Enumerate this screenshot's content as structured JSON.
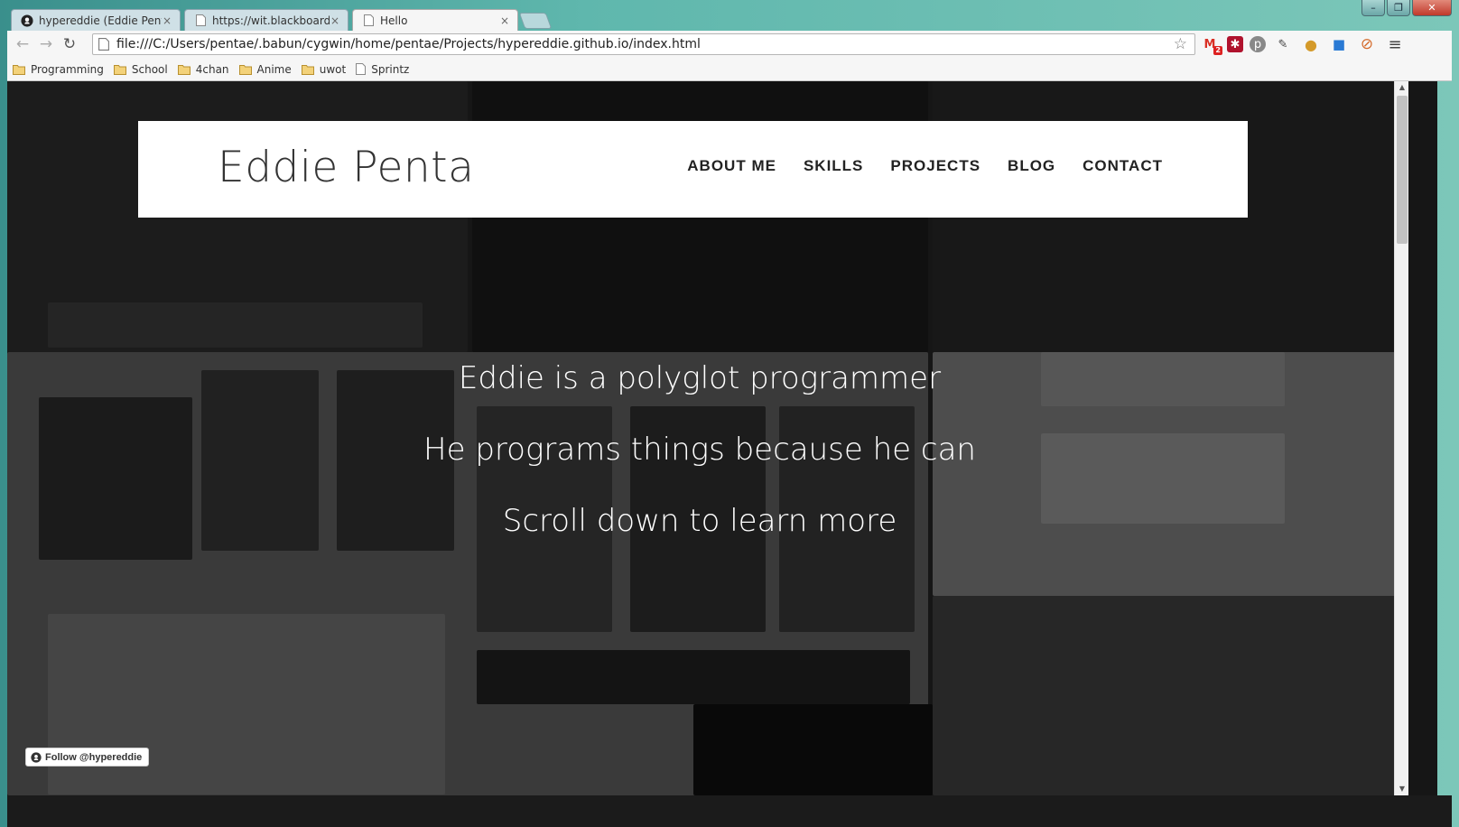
{
  "browser": {
    "tabs": [
      {
        "title": "hypereddie (Eddie Penta)",
        "icon": "github-icon"
      },
      {
        "title": "https://wit.blackboard.cor",
        "icon": "page-icon"
      },
      {
        "title": "Hello",
        "icon": "page-icon",
        "active": true
      }
    ],
    "tab_close_glyph": "×",
    "url": "file:///C:/Users/pentae/.babun/cygwin/home/pentae/Projects/hypereddie.github.io/index.html",
    "nav": {
      "back": "←",
      "forward": "→",
      "reload": "↻"
    },
    "star": "☆",
    "extensions": [
      {
        "name": "gmail-ext-icon",
        "glyph": "M",
        "color": "#d93025",
        "badge": "2"
      },
      {
        "name": "lastpass-ext-icon",
        "glyph": "✱",
        "color": "#b0122d"
      },
      {
        "name": "pushbullet-ext-icon",
        "glyph": "p",
        "color": "#777"
      },
      {
        "name": "eyedropper-ext-icon",
        "glyph": "✎",
        "color": "#444"
      },
      {
        "name": "cookie-ext-icon",
        "glyph": "●",
        "color": "#d49a2a"
      },
      {
        "name": "chat-ext-icon",
        "glyph": "■",
        "color": "#2a7ad4"
      },
      {
        "name": "blocker-ext-icon",
        "glyph": "⊘",
        "color": "#d46a2a"
      },
      {
        "name": "menu-icon",
        "glyph": "≡",
        "color": "#444"
      }
    ],
    "window_controls": {
      "minimize": "–",
      "restore": "❐",
      "close": "✕"
    }
  },
  "bookmarks": [
    {
      "label": "Programming",
      "type": "folder"
    },
    {
      "label": "School",
      "type": "folder"
    },
    {
      "label": "4chan",
      "type": "folder"
    },
    {
      "label": "Anime",
      "type": "folder"
    },
    {
      "label": "uwot",
      "type": "folder"
    },
    {
      "label": "Sprintz",
      "type": "page"
    }
  ],
  "page": {
    "brand": "Eddie Penta",
    "nav": [
      "ABOUT ME",
      "SKILLS",
      "PROJECTS",
      "BLOG",
      "CONTACT"
    ],
    "hero_lines": [
      "Eddie is a polyglot programmer",
      "He programs things because he can",
      "Scroll down to learn more"
    ],
    "follow_button": "Follow @hypereddie"
  },
  "colors": {
    "overlay": "#000000",
    "header_bg": "#ffffff",
    "hero_text": "#ffffff",
    "frame_accent": "#5fb7ad"
  }
}
